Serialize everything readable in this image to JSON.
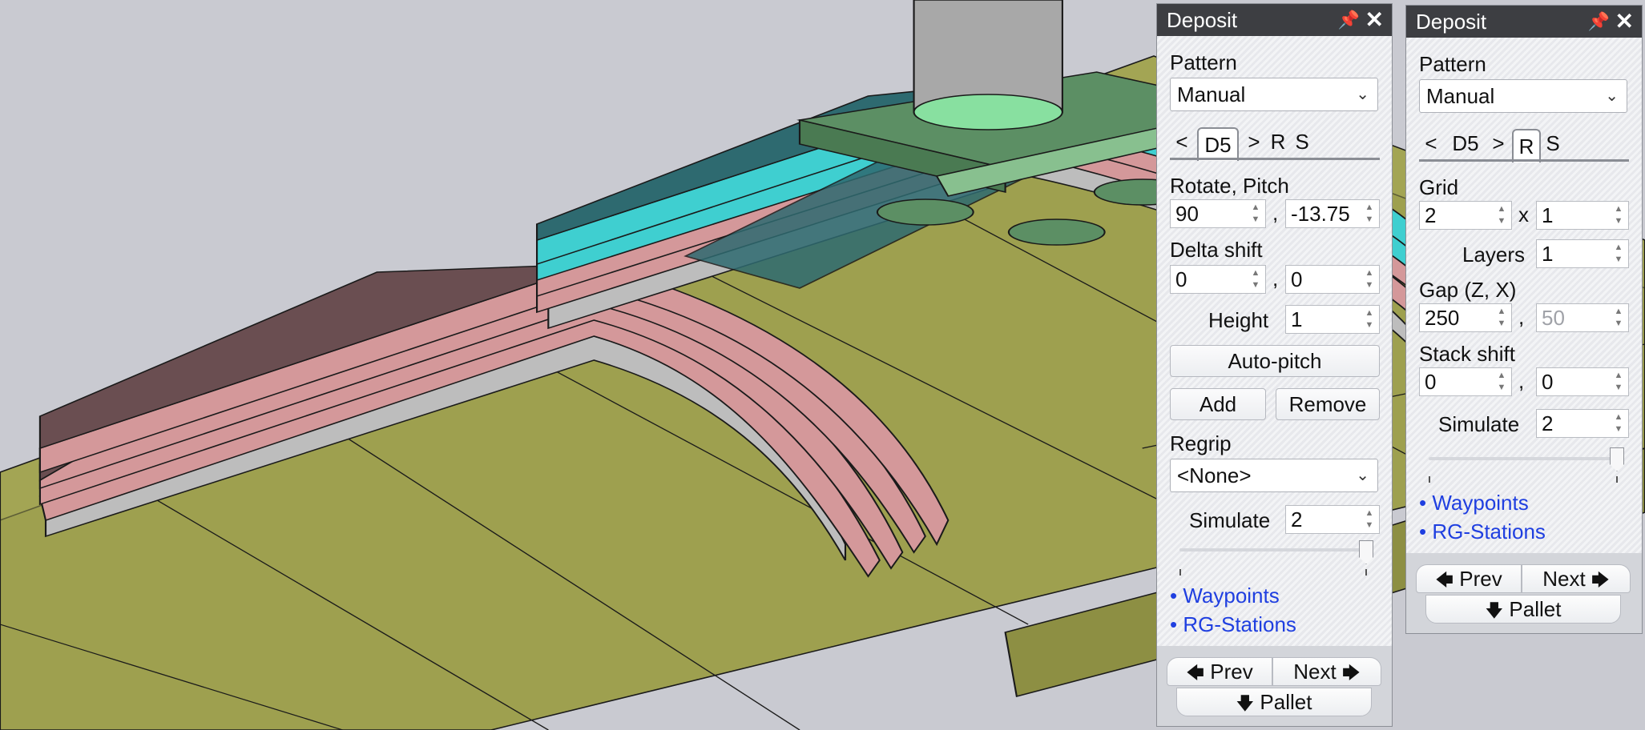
{
  "panels": [
    {
      "title": "Deposit",
      "pattern_label": "Pattern",
      "pattern_value": "Manual",
      "tabs": [
        "<",
        "D5",
        ">",
        "R",
        "S"
      ],
      "rotate_pitch_label": "Rotate, Pitch",
      "rotate": "90",
      "pitch": "-13.75",
      "delta_shift_label": "Delta shift",
      "delta_x": "0",
      "delta_y": "0",
      "height_label": "Height",
      "height_value": "1",
      "auto_pitch": "Auto-pitch",
      "add": "Add",
      "remove": "Remove",
      "regrip_label": "Regrip",
      "regrip_value": "<None>",
      "simulate_label": "Simulate",
      "simulate_value": "2",
      "links": [
        "• Waypoints",
        "• RG-Stations"
      ],
      "prev": "Prev",
      "next": "Next",
      "pallet": "Pallet"
    },
    {
      "title": "Deposit",
      "pattern_label": "Pattern",
      "pattern_value": "Manual",
      "tabs": [
        "<",
        "D5",
        ">",
        "R",
        "S"
      ],
      "grid_label": "Grid",
      "grid_x": "2",
      "grid_sep": "x",
      "grid_y": "1",
      "layers_label": "Layers",
      "layers_value": "1",
      "gap_label": "Gap (Z, X)",
      "gap_z": "250",
      "gap_x": "50",
      "stack_shift_label": "Stack shift",
      "stack_x": "0",
      "stack_y": "0",
      "simulate_label": "Simulate",
      "simulate_value": "2",
      "links": [
        "• Waypoints",
        "• RG-Stations"
      ],
      "prev": "Prev",
      "next": "Next",
      "pallet": "Pallet"
    }
  ],
  "colors": {
    "pallet": "#a3a554",
    "pink": "#d4989a",
    "pink_dark": "#6a4e51",
    "teal": "#3fcfd0",
    "teal_dark": "#2e6a70",
    "gripper": "#72b07a",
    "link": "#1f3fe0"
  }
}
